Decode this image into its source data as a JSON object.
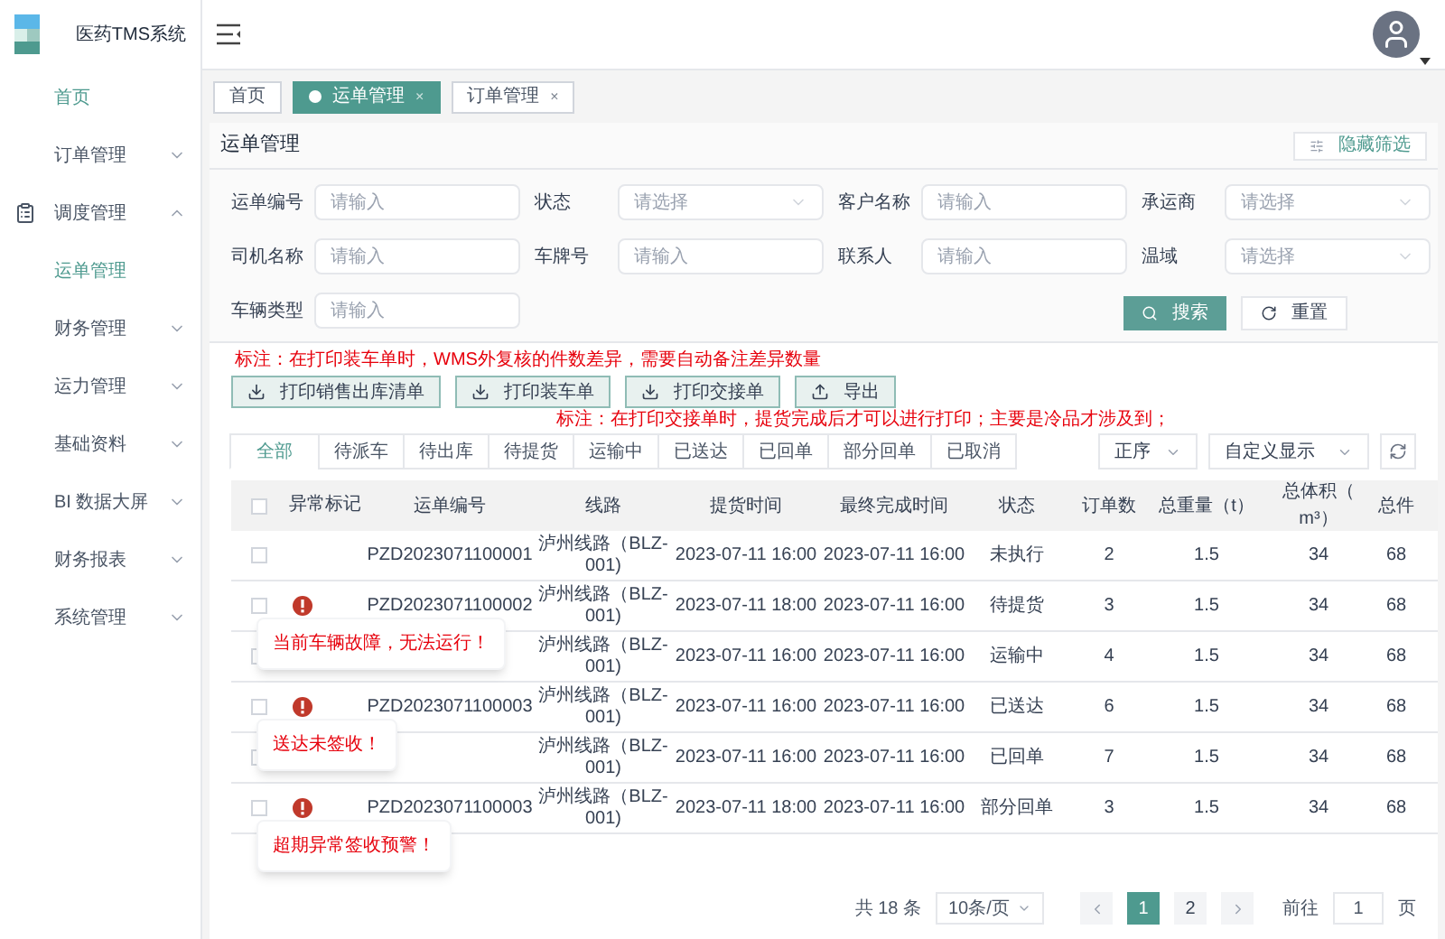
{
  "app": {
    "title": "医药TMS系统"
  },
  "sidebar": {
    "items": [
      {
        "kind": "link",
        "label": "首页",
        "selected": true
      },
      {
        "kind": "group",
        "label": "订单管理",
        "selected": false,
        "expanded": false
      },
      {
        "kind": "group",
        "label": "调度管理",
        "selected": false,
        "expanded": true,
        "children": [
          {
            "label": "运单管理",
            "selected": true
          }
        ]
      },
      {
        "kind": "group",
        "label": "财务管理",
        "selected": false,
        "expanded": false
      },
      {
        "kind": "group",
        "label": "运力管理",
        "selected": false,
        "expanded": false
      },
      {
        "kind": "group",
        "label": "基础资料",
        "selected": false,
        "expanded": false
      },
      {
        "kind": "group",
        "label": "BI 数据大屏",
        "selected": false,
        "expanded": false
      },
      {
        "kind": "group",
        "label": "财务报表",
        "selected": false,
        "expanded": false
      },
      {
        "kind": "group",
        "label": "系统管理",
        "selected": false,
        "expanded": false
      }
    ]
  },
  "page_tabs": [
    {
      "label": "首页",
      "selected": false,
      "closable": false
    },
    {
      "label": "运单管理",
      "selected": true,
      "closable": true,
      "close": "×"
    },
    {
      "label": "订单管理",
      "selected": false,
      "closable": true,
      "close": "×"
    }
  ],
  "page_title": "运单管理",
  "hide_filter_button": "隐藏筛选",
  "filters": [
    {
      "label": "运单编号",
      "kind": "input",
      "placeholder": "请输入"
    },
    {
      "label": "状态",
      "kind": "select",
      "placeholder": "请选择"
    },
    {
      "label": "客户名称",
      "kind": "input",
      "placeholder": "请输入"
    },
    {
      "label": "承运商",
      "kind": "select",
      "placeholder": "请选择"
    },
    {
      "label": "司机名称",
      "kind": "input",
      "placeholder": "请输入"
    },
    {
      "label": "车牌号",
      "kind": "input",
      "placeholder": "请输入"
    },
    {
      "label": "联系人",
      "kind": "input",
      "placeholder": "请输入"
    },
    {
      "label": "温域",
      "kind": "select",
      "placeholder": "请选择"
    },
    {
      "label": "车辆类型",
      "kind": "input",
      "placeholder": "请输入"
    }
  ],
  "search_button": "搜索",
  "reset_button": "重置",
  "note_1": "标注：在打印装车单时，WMS外复核的件数差异，需要自动备注差异数量",
  "actions": [
    {
      "label": "打印销售出库清单",
      "kind": "print"
    },
    {
      "label": "打印装车单",
      "kind": "print"
    },
    {
      "label": "打印交接单",
      "kind": "print"
    },
    {
      "label": "导出",
      "kind": "export"
    }
  ],
  "note_2": "标注：在打印交接单时，提货完成后才可以进行打印；主要是冷品才涉及到；",
  "status_tabs": [
    {
      "label": "全部",
      "selected": true
    },
    {
      "label": "待派车",
      "selected": false
    },
    {
      "label": "待出库",
      "selected": false
    },
    {
      "label": "待提货",
      "selected": false
    },
    {
      "label": "运输中",
      "selected": false
    },
    {
      "label": "已送达",
      "selected": false
    },
    {
      "label": "已回单",
      "selected": false
    },
    {
      "label": "部分回单",
      "selected": false
    },
    {
      "label": "已取消",
      "selected": false
    }
  ],
  "sort_select": "正序",
  "column_select": "自定义显示",
  "table": {
    "all_checked": false,
    "columns": [
      "异常标记",
      "运单编号",
      "线路",
      "提货时间",
      "最终完成时间",
      "状态",
      "订单数",
      "总重量（t）",
      "总体积（ m³）",
      "总件"
    ],
    "rows": [
      {
        "checked": false,
        "abnormal": false,
        "order_no": "PZD2023071100001",
        "route": "泸州线路（BLZ-001)",
        "pickup": "2023-07-11 16:00",
        "final": "2023-07-11 16:00",
        "status": "未执行",
        "orders": "2",
        "weight": "1.5",
        "volume": "34",
        "column_11": "68"
      },
      {
        "checked": false,
        "abnormal": true,
        "alert": "当前车辆故障，无法运行！",
        "order_no": "PZD2023071100002",
        "route": "泸州线路（BLZ-001)",
        "pickup": "2023-07-11 18:00",
        "final": "2023-07-11 16:00",
        "status": "待提货",
        "orders": "3",
        "weight": "1.5",
        "volume": "34",
        "column_11": "68"
      },
      {
        "checked": false,
        "abnormal": false,
        "route": "泸州线路（BLZ-001)",
        "pickup": "2023-07-11 16:00",
        "final": "2023-07-11 16:00",
        "status": "运输中",
        "orders": "4",
        "weight": "1.5",
        "volume": "34",
        "column_11": "68"
      },
      {
        "checked": false,
        "abnormal": true,
        "alert": "送达未签收！",
        "order_no": "PZD2023071100003",
        "route": "泸州线路（BLZ-001)",
        "pickup": "2023-07-11 16:00",
        "final": "2023-07-11 16:00",
        "status": "已送达",
        "orders": "6",
        "weight": "1.5",
        "volume": "34",
        "column_11": "68"
      },
      {
        "checked": false,
        "abnormal": false,
        "route": "泸州线路（BLZ-001)",
        "pickup": "2023-07-11 16:00",
        "final": "2023-07-11 16:00",
        "status": "已回单",
        "orders": "7",
        "weight": "1.5",
        "volume": "34",
        "column_11": "68"
      },
      {
        "checked": false,
        "abnormal": true,
        "alert": "超期异常签收预警！",
        "order_no": "PZD2023071100003",
        "route": "泸州线路（BLZ-001)",
        "pickup": "2023-07-11 18:00",
        "final": "2023-07-11 16:00",
        "status": "部分回单",
        "orders": "3",
        "weight": "1.5",
        "volume": "34",
        "column_11": "68"
      }
    ]
  },
  "pagination": {
    "total": "共 18 条",
    "page_size": "10条/页",
    "pages": [
      {
        "label": "1",
        "selected": true
      },
      {
        "label": "2",
        "selected": false
      }
    ],
    "goto_label": "前往",
    "goto_value": "1",
    "page_unit": "页"
  }
}
